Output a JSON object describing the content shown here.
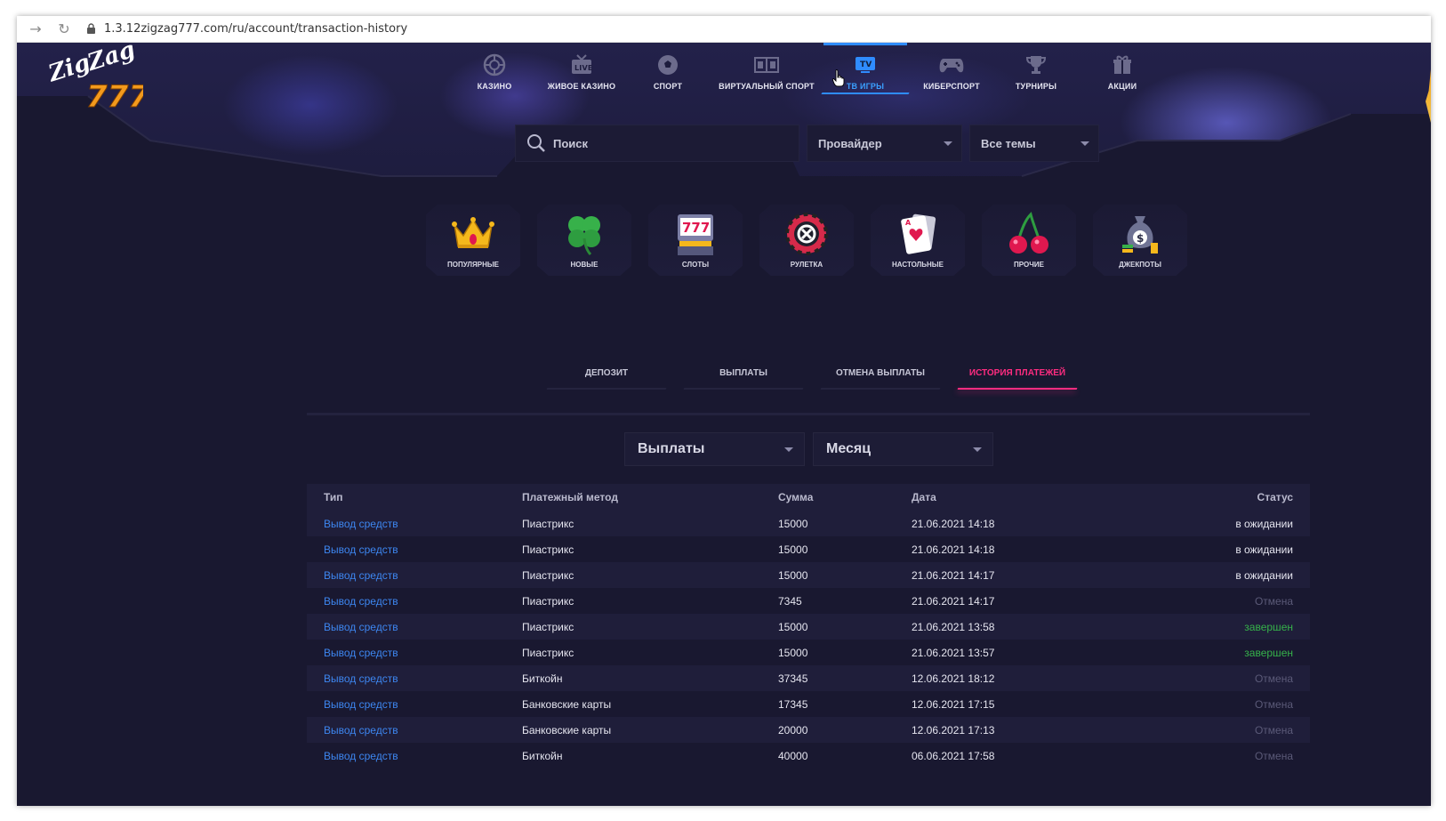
{
  "browser": {
    "url": "1.3.12zigzag777.com/ru/account/transaction-history"
  },
  "topnav": [
    {
      "label": "КАЗИНО",
      "icon": "casino-chip-icon"
    },
    {
      "label": "ЖИВОЕ КАЗИНО",
      "icon": "live-tv-icon"
    },
    {
      "label": "СПОРТ",
      "icon": "soccer-ball-icon"
    },
    {
      "label": "ВИРТУАЛЬНЫЙ СПОРТ",
      "icon": "virtual-scoreboard-icon"
    },
    {
      "label": "ТВ ИГРЫ",
      "icon": "tv-icon",
      "active": true
    },
    {
      "label": "КИБЕРСПОРТ",
      "icon": "gamepad-icon"
    },
    {
      "label": "ТУРНИРЫ",
      "icon": "trophy-icon"
    },
    {
      "label": "АКЦИИ",
      "icon": "gift-icon"
    }
  ],
  "search": {
    "placeholder": "Поиск",
    "provider": "Провайдер",
    "themes": "Все темы"
  },
  "categories": [
    {
      "label": "ПОПУЛЯРНЫЕ",
      "icon": "crown-icon"
    },
    {
      "label": "НОВЫЕ",
      "icon": "clover-icon"
    },
    {
      "label": "СЛОТЫ",
      "icon": "slot-machine-icon"
    },
    {
      "label": "РУЛЕТКА",
      "icon": "roulette-icon"
    },
    {
      "label": "НАСТОЛЬНЫЕ",
      "icon": "playing-card-icon"
    },
    {
      "label": "ПРОЧИЕ",
      "icon": "cherry-icon"
    },
    {
      "label": "ДЖЕКПОТЫ",
      "icon": "money-bag-icon"
    }
  ],
  "tabs": [
    {
      "label": "ДЕПОЗИТ"
    },
    {
      "label": "ВЫПЛАТЫ"
    },
    {
      "label": "ОТМЕНА ВЫПЛАТЫ"
    },
    {
      "label": "ИСТОРИЯ ПЛАТЕЖЕЙ",
      "active": true
    }
  ],
  "filters": {
    "type": "Выплаты",
    "period": "Месяц"
  },
  "table": {
    "headers": [
      "Тип",
      "Платежный метод",
      "Сумма",
      "Дата",
      "Статус"
    ],
    "rows": [
      {
        "type": "Вывод средств",
        "method": "Пиастрикс",
        "amount": "15000",
        "date": "21.06.2021 14:18",
        "status": "в ожидании",
        "status_kind": "wait"
      },
      {
        "type": "Вывод средств",
        "method": "Пиастрикс",
        "amount": "15000",
        "date": "21.06.2021 14:18",
        "status": "в ожидании",
        "status_kind": "wait"
      },
      {
        "type": "Вывод средств",
        "method": "Пиастрикс",
        "amount": "15000",
        "date": "21.06.2021 14:17",
        "status": "в ожидании",
        "status_kind": "wait"
      },
      {
        "type": "Вывод средств",
        "method": "Пиастрикс",
        "amount": "7345",
        "date": "21.06.2021 14:17",
        "status": "Отмена",
        "status_kind": "cancel"
      },
      {
        "type": "Вывод средств",
        "method": "Пиастрикс",
        "amount": "15000",
        "date": "21.06.2021 13:58",
        "status": "завершен",
        "status_kind": "done"
      },
      {
        "type": "Вывод средств",
        "method": "Пиастрикс",
        "amount": "15000",
        "date": "21.06.2021 13:57",
        "status": "завершен",
        "status_kind": "done"
      },
      {
        "type": "Вывод средств",
        "method": "Биткойн",
        "amount": "37345",
        "date": "12.06.2021 18:12",
        "status": "Отмена",
        "status_kind": "cancel"
      },
      {
        "type": "Вывод средств",
        "method": "Банковские карты",
        "amount": "17345",
        "date": "12.06.2021 17:15",
        "status": "Отмена",
        "status_kind": "cancel"
      },
      {
        "type": "Вывод средств",
        "method": "Банковские карты",
        "amount": "20000",
        "date": "12.06.2021 17:13",
        "status": "Отмена",
        "status_kind": "cancel"
      },
      {
        "type": "Вывод средств",
        "method": "Биткойн",
        "amount": "40000",
        "date": "06.06.2021 17:58",
        "status": "Отмена",
        "status_kind": "cancel"
      }
    ]
  },
  "colors": {
    "background": "#191830",
    "accent_blue": "#3aa0ff",
    "accent_pink": "#ff2c80",
    "link": "#3d86f0",
    "done_green": "#36b24a"
  }
}
